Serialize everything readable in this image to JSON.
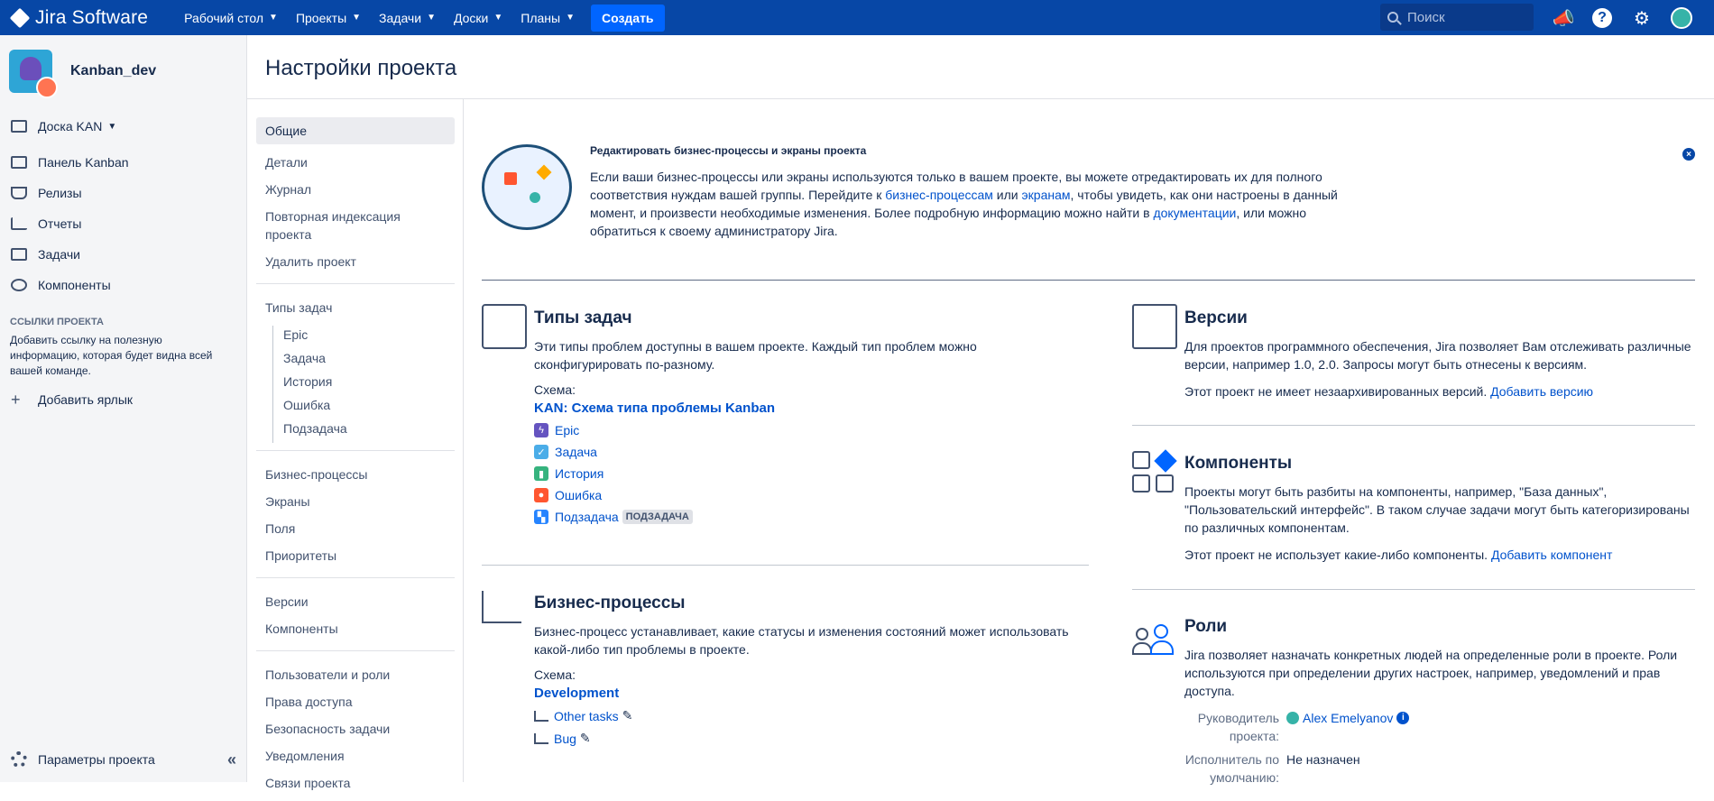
{
  "topbar": {
    "product": "Jira Software",
    "nav": [
      "Рабочий стол",
      "Проекты",
      "Задачи",
      "Доски",
      "Планы"
    ],
    "create": "Создать",
    "search_placeholder": "Поиск"
  },
  "sidebar": {
    "project_name": "Kanban_dev",
    "board": "Доска KAN",
    "items": [
      "Панель Kanban",
      "Релизы",
      "Отчеты",
      "Задачи",
      "Компоненты"
    ],
    "links_heading": "ССЫЛКИ ПРОЕКТА",
    "links_desc": "Добавить ссылку на полезную информацию, которая будет видна всей вашей команде.",
    "add_label": "Добавить ярлык",
    "settings": "Параметры проекта"
  },
  "page_title": "Настройки проекта",
  "subnav": {
    "general": "Общие",
    "group1": [
      "Детали",
      "Журнал",
      "Повторная индексация проекта",
      "Удалить проект"
    ],
    "issue_types": "Типы задач",
    "issue_subtypes": [
      "Epic",
      "Задача",
      "История",
      "Ошибка",
      "Подзадача"
    ],
    "group2": [
      "Бизнес-процессы",
      "Экраны",
      "Поля",
      "Приоритеты"
    ],
    "group3": [
      "Версии",
      "Компоненты"
    ],
    "group4": [
      "Пользователи и роли",
      "Права доступа",
      "Безопасность задачи",
      "Уведомления",
      "Связи проекта"
    ]
  },
  "banner": {
    "title": "Редактировать бизнес-процессы и экраны проекта",
    "text1": "Если ваши бизнес-процессы или экраны используются только в вашем проекте, вы можете отредактировать их для полного соответствия нуждам вашей группы. Перейдите к ",
    "link1": "бизнес-процессам",
    "text2": " или ",
    "link2": "экранам",
    "text3": ", чтобы увидеть, как они настроены в данный момент, и произвести необходимые изменения. Более подробную информацию можно найти в ",
    "link3": "документации",
    "text4": ", или можно обратиться к своему администратору Jira."
  },
  "issue_types": {
    "title": "Типы задач",
    "desc": "Эти типы проблем доступны в вашем проекте. Каждый тип проблем можно сконфигурировать по-разному.",
    "scheme_label": "Схема:",
    "scheme": "KAN: Схема типа проблемы Kanban",
    "types": [
      {
        "name": "Epic",
        "color": "#6554c0"
      },
      {
        "name": "Задача",
        "color": "#4bade8"
      },
      {
        "name": "История",
        "color": "#36b37e"
      },
      {
        "name": "Ошибка",
        "color": "#ff5630"
      },
      {
        "name": "Подзадача",
        "color": "#2684ff"
      }
    ],
    "subtask_tag": "ПОДЗАДАЧА"
  },
  "workflows": {
    "title": "Бизнес-процессы",
    "desc": "Бизнес-процесс устанавливает, какие статусы и изменения состояний может использовать какой-либо тип проблемы в проекте.",
    "scheme_label": "Схема:",
    "scheme": "Development",
    "items": [
      "Other tasks",
      "Bug"
    ]
  },
  "versions": {
    "title": "Версии",
    "desc": "Для проектов программного обеспечения, Jira позволяет Вам отслеживать различные версии, например 1.0, 2.0. Запросы могут быть отнесены к версиям.",
    "none": "Этот проект не имеет незаархивированных версий. ",
    "add": "Добавить версию"
  },
  "components": {
    "title": "Компоненты",
    "desc": "Проекты могут быть разбиты на компоненты, например, \"База данных\", \"Пользовательский интерфейс\". В таком случае задачи могут быть категоризированы по различных компонентам.",
    "none": "Этот проект не использует какие-либо компоненты. ",
    "add": "Добавить компонент"
  },
  "roles": {
    "title": "Роли",
    "desc": "Jira позволяет назначать конкретных людей на определенные роли в проекте. Роли используются при определении других настроек, например, уведомлений и прав доступа.",
    "lead_label": "Руководитель проекта:",
    "lead": "Alex Emelyanov",
    "assignee_label": "Исполнитель по умолчанию:",
    "assignee": "Не назначен"
  }
}
